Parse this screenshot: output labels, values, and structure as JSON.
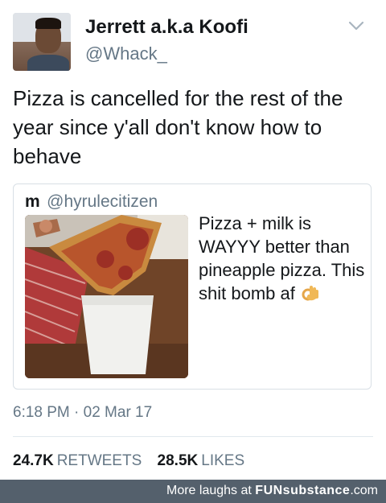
{
  "tweet": {
    "author_name": "Jerrett a.k.a Koofi",
    "author_handle": "@Whack_",
    "text": "Pizza is cancelled for the rest of the year since y'all don't know how to behave",
    "timestamp": "6:18 PM · 02 Mar 17",
    "options_icon": "chevron-down-icon"
  },
  "quoted_tweet": {
    "author_name": "m",
    "author_handle": "@hyrulecitizen",
    "text": "Pizza + milk is WAYYY better than pineapple pizza. This shit bomb af",
    "emoji_icon": "ok-hand-icon"
  },
  "stats": {
    "retweets_count": "24.7K",
    "retweets_label": "RETWEETS",
    "likes_count": "28.5K",
    "likes_label": "LIKES"
  },
  "footer": {
    "text": "More laughs at",
    "brand_bold": "FUNsubstance",
    "brand_suffix": ".com"
  },
  "colors": {
    "text_primary": "#14171a",
    "text_secondary": "#657786",
    "border": "#d8dfe5",
    "footer_bg": "#54606c"
  }
}
